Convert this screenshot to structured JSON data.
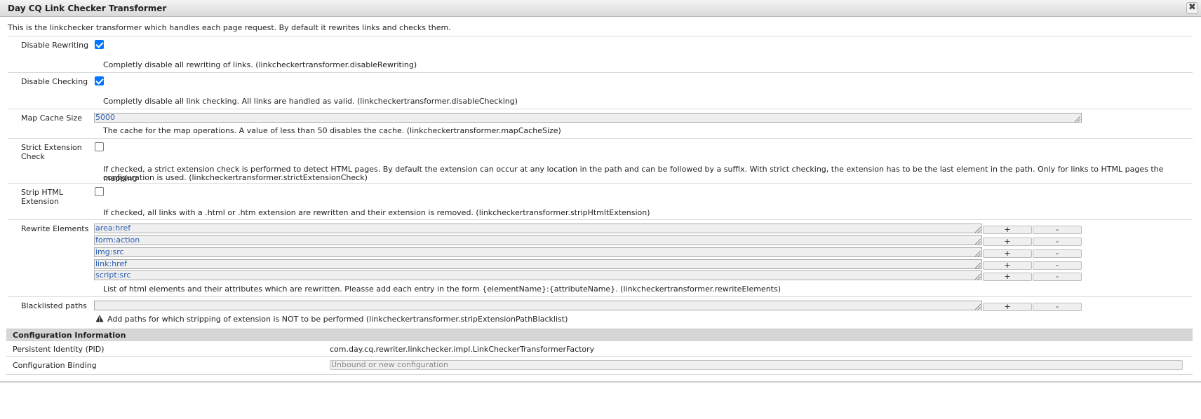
{
  "dialog": {
    "title": "Day CQ Link Checker Transformer",
    "close_glyph": "✖",
    "description": "This is the linkchecker transformer which handles each page request. By default it rewrites links and checks them."
  },
  "properties": {
    "disable_rewriting": {
      "label": "Disable Rewriting",
      "checked": true,
      "help": "Completly disable all rewriting of links. (linkcheckertransformer.disableRewriting)"
    },
    "disable_checking": {
      "label": "Disable Checking",
      "checked": true,
      "help": "Completly disable all link checking. All links are handled as valid. (linkcheckertransformer.disableChecking)"
    },
    "map_cache_size": {
      "label": "Map Cache Size",
      "value": "5000",
      "help": "The cache for the map operations. A value of less than 50 disables the cache. (linkcheckertransformer.mapCacheSize)"
    },
    "strict_extension_check": {
      "label": "Strict Extension Check",
      "checked": false,
      "help_line1": "If checked, a strict extension check is performed to detect HTML pages. By default the extension can occur at any location in the path and can be followed by a suffix. With strict checking, the extension has to be the last element in the path. Only for links to HTML pages the mapping",
      "help_line2": "configuration is used. (linkcheckertransformer.strictExtensionCheck)"
    },
    "strip_html_extension": {
      "label": "Strip HTML Extension",
      "checked": false,
      "help": "If checked, all links with a .html or .htm extension are rewritten and their extension is removed. (linkcheckertransformer.stripHtmltExtension)"
    },
    "rewrite_elements": {
      "label": "Rewrite Elements",
      "values": [
        "area:href",
        "form:action",
        "img:src",
        "link:href",
        "script:src"
      ],
      "add_label": "+",
      "remove_label": "-",
      "help": "List of html elements and their attributes which are rewritten. Pleasse add each entry in the form {elementName}:{attributeName}. (linkcheckertransformer.rewriteElements)"
    },
    "blacklisted_paths": {
      "label": "Blacklisted paths",
      "value": "",
      "add_label": "+",
      "remove_label": "-",
      "help": "Add paths for which stripping of extension is NOT to be performed (linkcheckertransformer.stripExtensionPathBlacklist)",
      "help_icon": "warning-icon"
    }
  },
  "config_info": {
    "header": "Configuration Information",
    "pid_label": "Persistent Identity (PID)",
    "pid_value": "com.day.cq.rewriter.linkchecker.impl.LinkCheckerTransformerFactory",
    "binding_label": "Configuration Binding",
    "binding_value": "Unbound or new configuration"
  }
}
